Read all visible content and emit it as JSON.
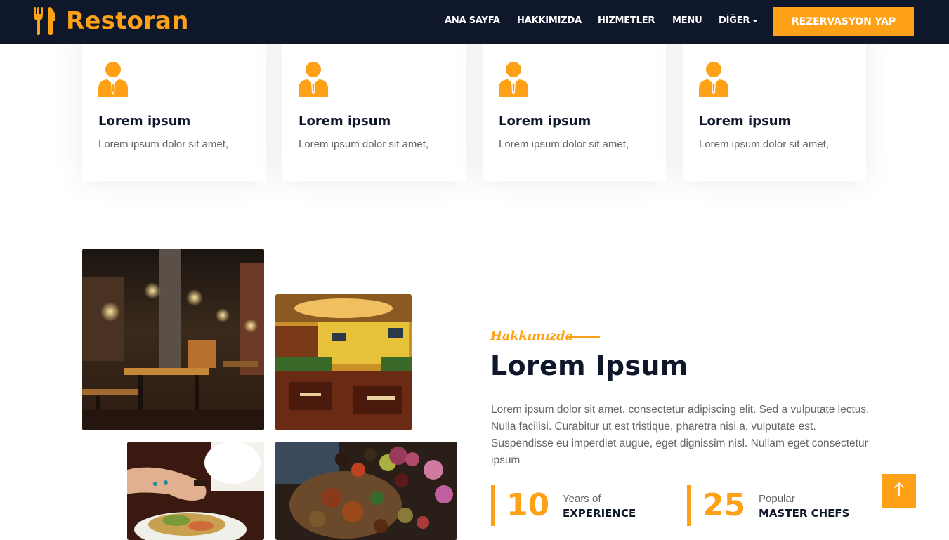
{
  "brand": {
    "name": "Restoran",
    "icon": "utensils-icon"
  },
  "nav": {
    "items": [
      "ANA SAYFA",
      "HAKKIMIZDA",
      "HIZMETLER",
      "MENU",
      "DİĞER"
    ],
    "cta": "REZERVASYON YAP"
  },
  "services": [
    {
      "icon": "user-tie-icon",
      "title": "Lorem ipsum",
      "text": "Lorem ipsum dolor sit amet,"
    },
    {
      "icon": "user-tie-icon",
      "title": "Lorem ipsum",
      "text": "Lorem ipsum dolor sit amet,"
    },
    {
      "icon": "user-tie-icon",
      "title": "Lorem ipsum",
      "text": "Lorem ipsum dolor sit amet,"
    },
    {
      "icon": "user-tie-icon",
      "title": "Lorem ipsum",
      "text": "Lorem ipsum dolor sit amet,"
    }
  ],
  "about": {
    "eyebrow": "Hakkımızda",
    "title": "Lorem Ipsum",
    "text": "Lorem ipsum dolor sit amet, consectetur adipiscing elit. Sed a vulputate lectus. Nulla facilisi. Curabitur ut est tristique, pharetra nisi a, vulputate est. Suspendisse eu imperdiet augue, eget dignissim nisl. Nullam eget consectetur ipsum",
    "stats": [
      {
        "number": "10",
        "small": "Years of",
        "big": "EXPERIENCE"
      },
      {
        "number": "25",
        "small": "Popular",
        "big": "MASTER CHEFS"
      }
    ]
  },
  "colors": {
    "primary": "#fea116",
    "dark": "#0f172b",
    "body_text": "#666565"
  },
  "back_to_top_icon": "arrow-up-icon"
}
